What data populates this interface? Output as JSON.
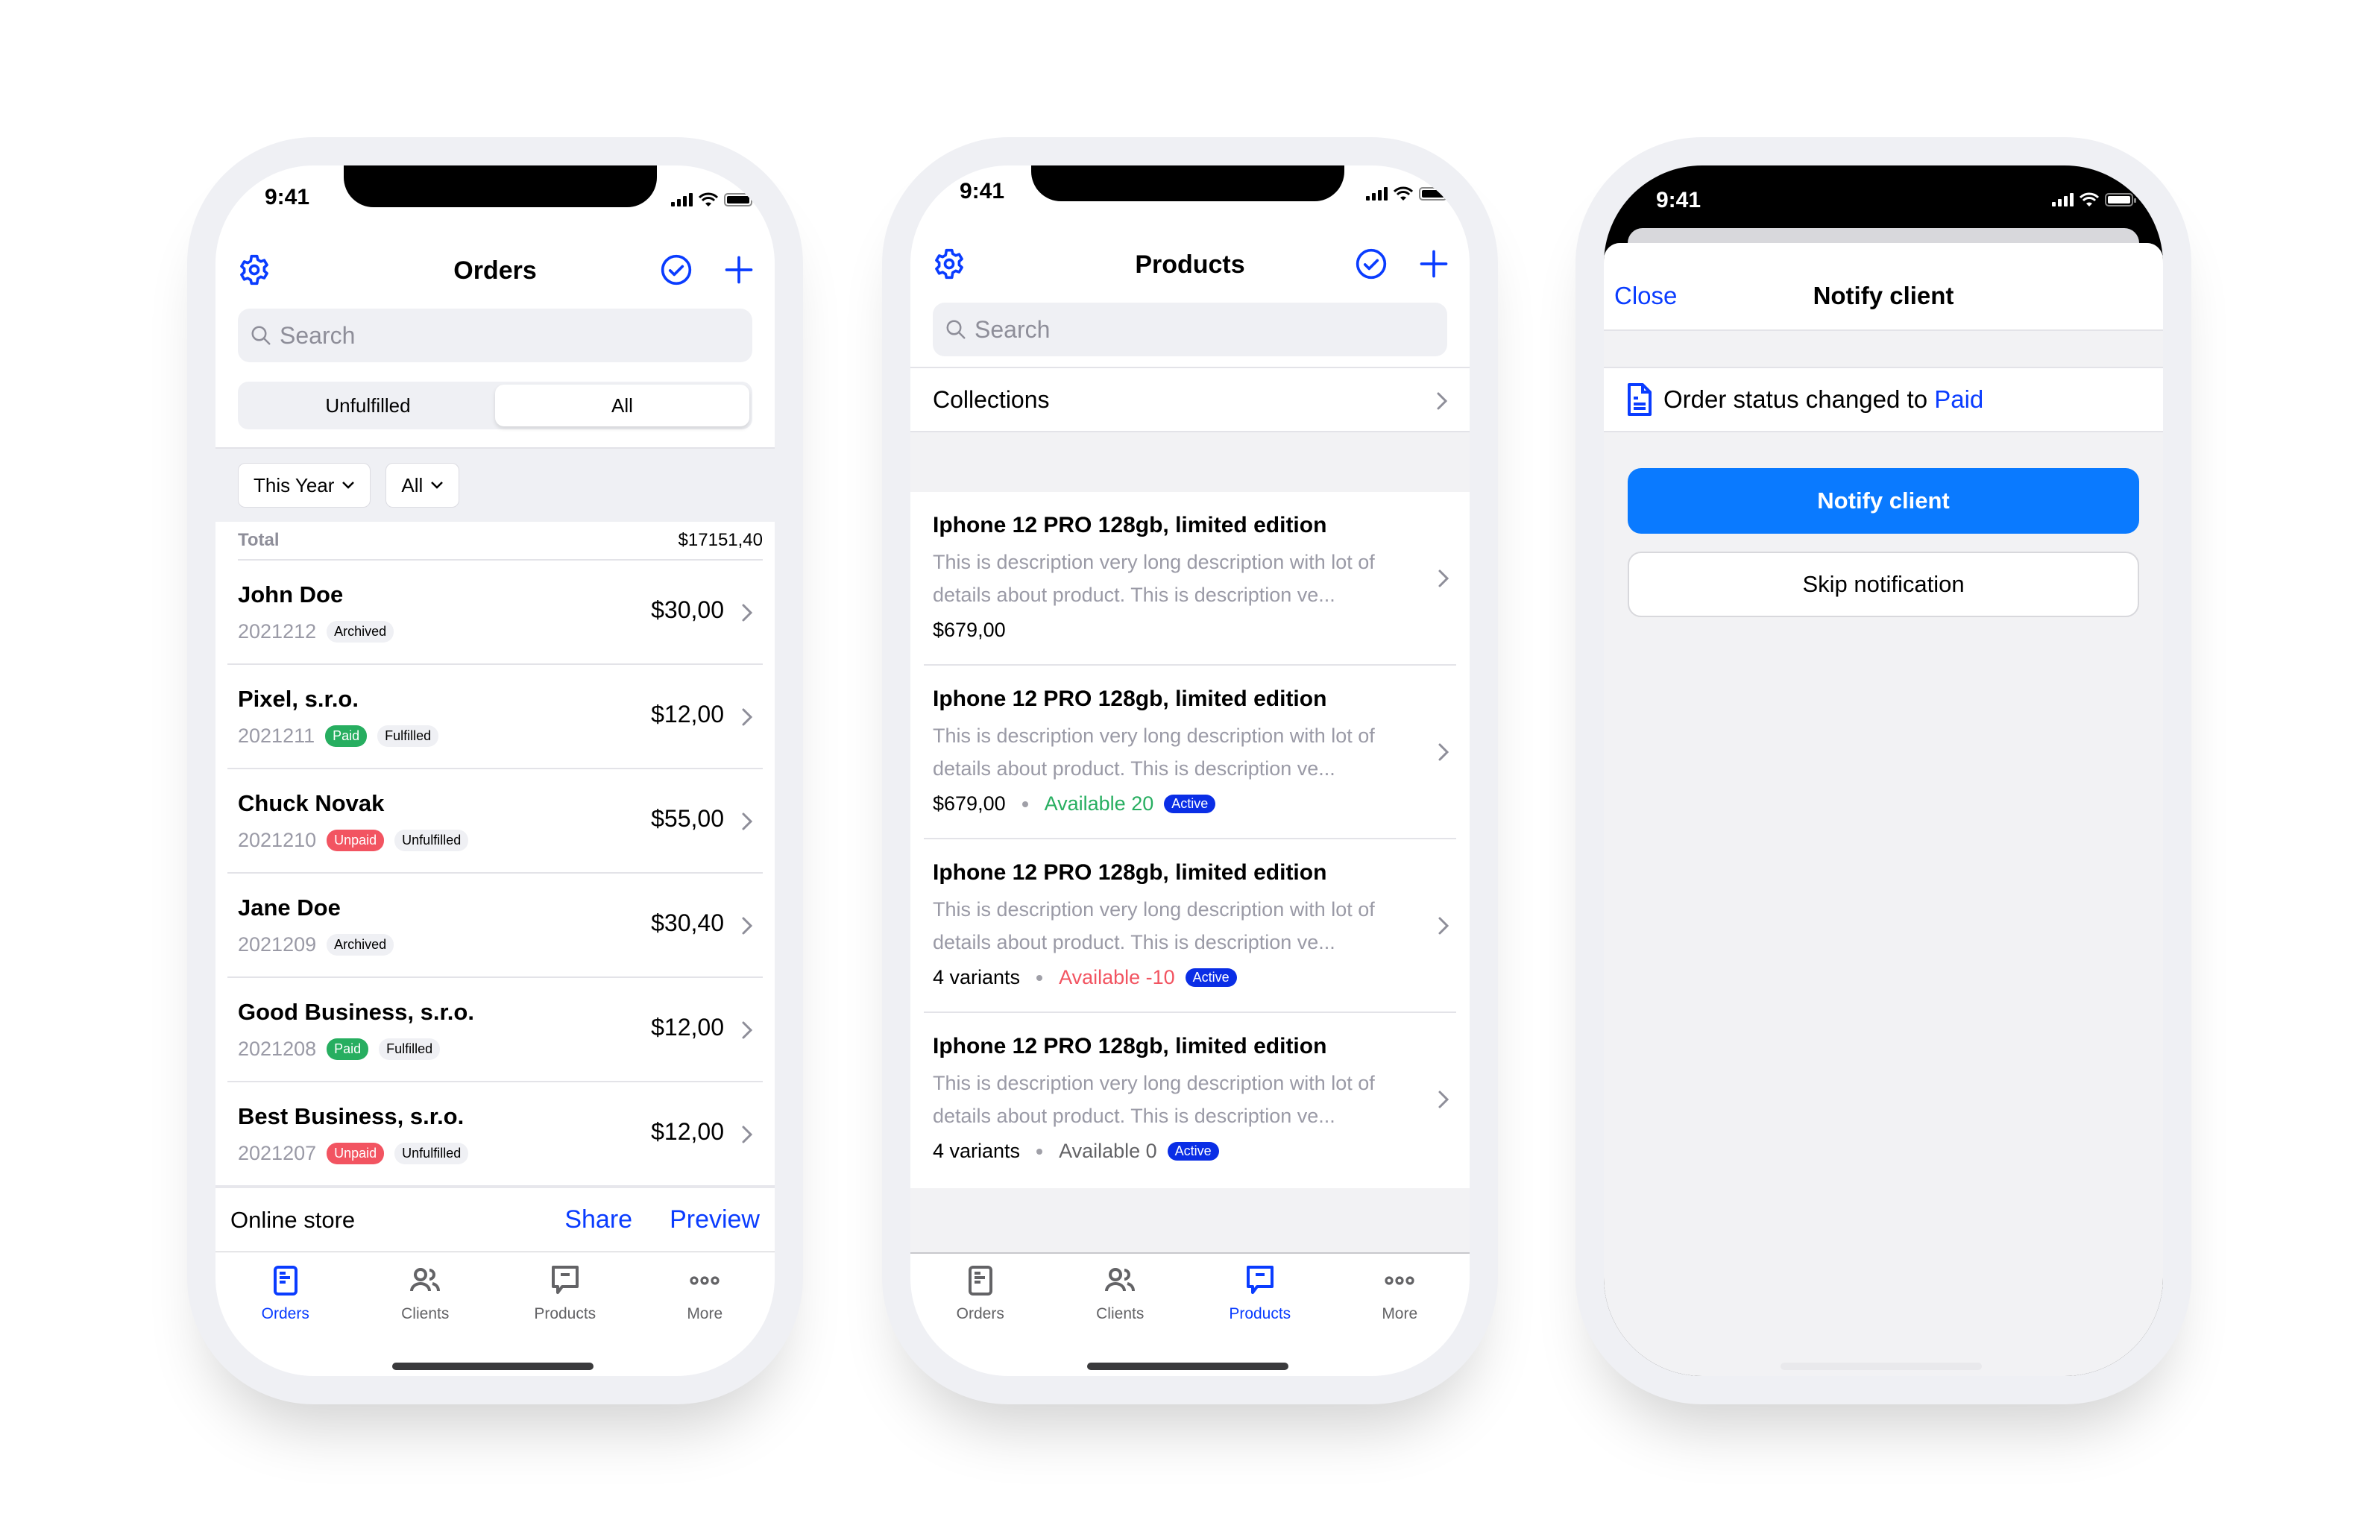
{
  "accent_color": "#0a3cff",
  "status_bar": {
    "time": "9:41"
  },
  "orders_screen": {
    "title": "Orders",
    "search_placeholder": "Search",
    "segments": [
      {
        "label": "Unfulfilled",
        "active": false
      },
      {
        "label": "All",
        "active": true
      }
    ],
    "filters": [
      {
        "label": "This Year"
      },
      {
        "label": "All"
      }
    ],
    "total": {
      "label": "Total",
      "value": "$17151,40"
    },
    "orders": [
      {
        "name": "John Doe",
        "id": "2021212",
        "payment": "",
        "fulfillment": "Archived",
        "amount": "$30,00"
      },
      {
        "name": "Pixel, s.r.o.",
        "id": "2021211",
        "payment": "Paid",
        "fulfillment": "Fulfilled",
        "amount": "$12,00"
      },
      {
        "name": "Chuck Novak",
        "id": "2021210",
        "payment": "Unpaid",
        "fulfillment": "Unfulfilled",
        "amount": "$55,00"
      },
      {
        "name": "Jane Doe",
        "id": "2021209",
        "payment": "",
        "fulfillment": "Archived",
        "amount": "$30,40"
      },
      {
        "name": "Good Business, s.r.o.",
        "id": "2021208",
        "payment": "Paid",
        "fulfillment": "Fulfilled",
        "amount": "$12,00"
      },
      {
        "name": "Best Business, s.r.o.",
        "id": "2021207",
        "payment": "Unpaid",
        "fulfillment": "Unfulfilled",
        "amount": "$12,00"
      }
    ],
    "online_store": {
      "label": "Online store",
      "share": "Share",
      "preview": "Preview"
    },
    "active_tab": "Orders"
  },
  "products_screen": {
    "title": "Products",
    "search_placeholder": "Search",
    "collections_label": "Collections",
    "products": [
      {
        "title": "Iphone 12 PRO 128gb, limited edition",
        "description": "This is description very long description with lot of details about product. This is description ve...",
        "price_or_variants": "$679,00",
        "availability": "",
        "availability_state": "",
        "status": ""
      },
      {
        "title": "Iphone 12 PRO 128gb, limited edition",
        "description": "This is description very long description with lot of details about product. This is description ve...",
        "price_or_variants": "$679,00",
        "availability": "Available 20",
        "availability_state": "positive",
        "status": "Active"
      },
      {
        "title": "Iphone 12 PRO 128gb, limited edition",
        "description": "This is description very long description with lot of details about product. This is description ve...",
        "price_or_variants": "4 variants",
        "availability": "Available -10",
        "availability_state": "negative",
        "status": "Active"
      },
      {
        "title": "Iphone 12 PRO 128gb, limited edition",
        "description": "This is description very long description with lot of details about product. This is description ve...",
        "price_or_variants": "4 variants",
        "availability": "Available 0",
        "availability_state": "zero",
        "status": "Active"
      }
    ],
    "active_tab": "Products"
  },
  "notify_screen": {
    "close": "Close",
    "title": "Notify client",
    "status_message": "Order status changed to",
    "status_value": "Paid",
    "primary_button": "Notify client",
    "secondary_button": "Skip notification"
  },
  "tabs": [
    {
      "label": "Orders",
      "icon": "orders-icon"
    },
    {
      "label": "Clients",
      "icon": "clients-icon"
    },
    {
      "label": "Products",
      "icon": "products-icon"
    },
    {
      "label": "More",
      "icon": "more-icon"
    }
  ]
}
